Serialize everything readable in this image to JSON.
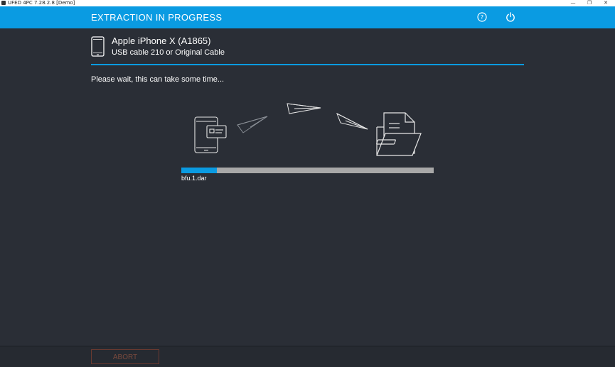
{
  "window": {
    "title": "UFED 4PC 7.28.2.8 [Demo]",
    "controls": {
      "minimize": "—",
      "restore": "❐",
      "close": "✕"
    }
  },
  "header": {
    "title": "EXTRACTION IN PROGRESS",
    "icons": [
      "help-icon",
      "power-icon"
    ],
    "color": "#0a9be2"
  },
  "device": {
    "name": "Apple iPhone X (A1865)",
    "connection": "USB cable 210 or Original Cable",
    "icon": "phone-icon"
  },
  "status": {
    "message": "Please wait, this can take some time..."
  },
  "progress": {
    "fraction": 0.14,
    "file": "bfu.1.dar"
  },
  "footer": {
    "abort_label": "ABORT"
  },
  "colors": {
    "background": "#2a2e36",
    "accent": "#0a9be2",
    "track": "#a8a8a8",
    "abort": "#7a4a3d"
  }
}
